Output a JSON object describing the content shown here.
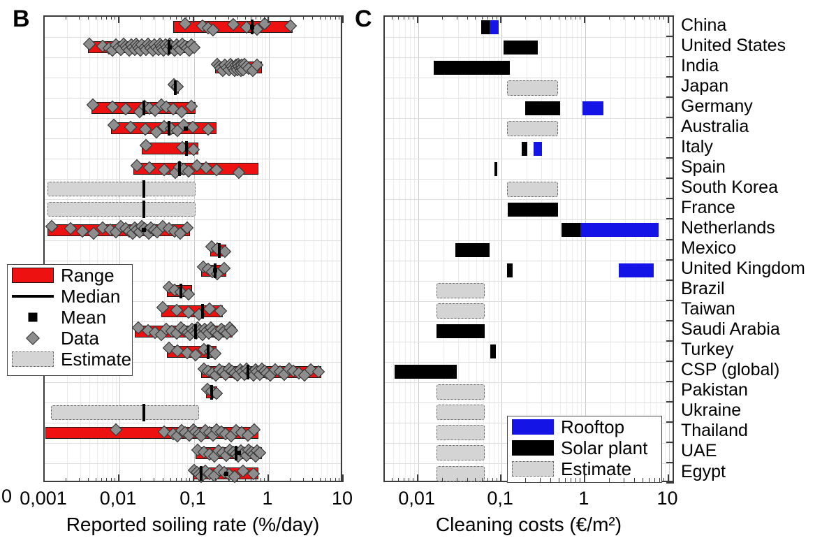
{
  "figure": {
    "panels": [
      {
        "letter": "B",
        "axis_title": "Reported soiling rate (%/day)"
      },
      {
        "letter": "C",
        "axis_title": "Cleaning costs (€/m²)"
      }
    ],
    "zero_label": "0"
  },
  "categories": [
    "China",
    "United States",
    "India",
    "Japan",
    "Germany",
    "Australia",
    "Italy",
    "Spain",
    "South Korea",
    "France",
    "Netherlands",
    "Mexico",
    "United Kingdom",
    "Brazil",
    "Taiwan",
    "Saudi Arabia",
    "Turkey",
    "CSP (global)",
    "Pakistan",
    "Ukraine",
    "Thailand",
    "UAE",
    "Egypt"
  ],
  "legend_b": {
    "items": [
      {
        "label": "Range",
        "kind": "red"
      },
      {
        "label": "Median",
        "kind": "line"
      },
      {
        "label": "Mean",
        "kind": "sq"
      },
      {
        "label": "Data",
        "kind": "dia"
      },
      {
        "label": "Estimate",
        "kind": "est"
      }
    ]
  },
  "legend_c": {
    "items": [
      {
        "label": "Rooftop",
        "kind": "blue"
      },
      {
        "label": "Solar plant",
        "kind": "black"
      },
      {
        "label": "Estimate",
        "kind": "est"
      }
    ]
  },
  "colors": {
    "range": "#ee1111",
    "rooftop": "#1414e6",
    "solar_plant": "#000000",
    "estimate": "#d4d4d4",
    "data_marker": "#8d8d8d"
  },
  "chart_data": [
    {
      "type": "bar",
      "id": "panel_b",
      "title": "B",
      "xlabel": "Reported soiling rate (%/day)",
      "ylabel": "",
      "xscale": "log",
      "xlim": [
        0.001,
        10
      ],
      "xticks": [
        0.001,
        0.01,
        0.1,
        1,
        10
      ],
      "xticklabels": [
        "0,001",
        "0,01",
        "0,1",
        "1",
        "10"
      ],
      "grid": true,
      "legend": [
        "Range",
        "Median",
        "Mean",
        "Data",
        "Estimate"
      ],
      "categories": [
        "China",
        "United States",
        "India",
        "Japan",
        "Germany",
        "Australia",
        "Italy",
        "Spain",
        "South Korea",
        "France",
        "Netherlands",
        "Mexico",
        "United Kingdom",
        "Brazil",
        "Taiwan",
        "Saudi Arabia",
        "Turkey",
        "CSP (global)",
        "Pakistan",
        "Ukraine",
        "Thailand",
        "UAE",
        "Egypt"
      ],
      "series": [
        {
          "category": "China",
          "kind": "range",
          "low": 0.052,
          "high": 2.1,
          "median": 0.6,
          "mean": 0.6,
          "n_data": 9
        },
        {
          "category": "United States",
          "kind": "range",
          "low": 0.0038,
          "high": 0.105,
          "median": 0.046,
          "mean": 0.047,
          "n_data": 48
        },
        {
          "category": "India",
          "kind": "range",
          "low": 0.19,
          "high": 0.8,
          "median": null,
          "mean": null,
          "n_data": 26
        },
        {
          "category": "Japan",
          "kind": "range",
          "low": 0.053,
          "high": 0.062,
          "median": 0.056,
          "mean": null,
          "n_data": 2
        },
        {
          "category": "Germany",
          "kind": "range",
          "low": 0.0042,
          "high": 0.105,
          "median": 0.021,
          "mean": null,
          "n_data": 12
        },
        {
          "category": "Australia",
          "kind": "range",
          "low": 0.0077,
          "high": 0.2,
          "median": 0.046,
          "mean": 0.077,
          "n_data": 10
        },
        {
          "category": "Italy",
          "kind": "range",
          "low": 0.02,
          "high": 0.115,
          "median": 0.078,
          "mean": null,
          "n_data": 3
        },
        {
          "category": "Spain",
          "kind": "range",
          "low": 0.0155,
          "high": 0.72,
          "median": 0.063,
          "mean": null,
          "n_data": 11
        },
        {
          "category": "South Korea",
          "kind": "estimate",
          "low": 0.0011,
          "high": 0.105,
          "median": 0.021,
          "mean": null,
          "n_data": 0
        },
        {
          "category": "France",
          "kind": "estimate",
          "low": 0.0011,
          "high": 0.105,
          "median": 0.021,
          "mean": null,
          "n_data": 0
        },
        {
          "category": "Netherlands",
          "kind": "range",
          "low": 0.0011,
          "high": 0.088,
          "median": null,
          "mean": 0.021,
          "n_data": 26
        },
        {
          "category": "Mexico",
          "kind": "range",
          "low": 0.165,
          "high": 0.27,
          "median": 0.215,
          "mean": null,
          "n_data": 3
        },
        {
          "category": "United Kingdom",
          "kind": "range",
          "low": 0.125,
          "high": 0.27,
          "median": 0.19,
          "mean": 0.19,
          "n_data": 5
        },
        {
          "category": "Brazil",
          "kind": "range",
          "low": 0.043,
          "high": 0.093,
          "median": 0.066,
          "mean": null,
          "n_data": 4
        },
        {
          "category": "Taiwan",
          "kind": "range",
          "low": 0.036,
          "high": 0.24,
          "median": 0.13,
          "mean": null,
          "n_data": 6
        },
        {
          "category": "Saudi Arabia",
          "kind": "range",
          "low": 0.016,
          "high": 0.33,
          "median": 0.105,
          "mean": null,
          "n_data": 30
        },
        {
          "category": "Turkey",
          "kind": "range",
          "low": 0.043,
          "high": 0.2,
          "median": 0.155,
          "mean": null,
          "n_data": 7
        },
        {
          "category": "CSP (global)",
          "kind": "range",
          "low": 0.125,
          "high": 5.0,
          "median": 0.52,
          "mean": null,
          "n_data": 34
        },
        {
          "category": "Pakistan",
          "kind": "range",
          "low": 0.145,
          "high": 0.205,
          "median": 0.17,
          "mean": null,
          "n_data": 3
        },
        {
          "category": "Ukraine",
          "kind": "estimate",
          "low": 0.0012,
          "high": 0.115,
          "median": 0.021,
          "mean": null,
          "n_data": 0
        },
        {
          "category": "Thailand",
          "kind": "range",
          "low": 0.00102,
          "high": 0.72,
          "median": null,
          "mean": null,
          "n_data": 22
        },
        {
          "category": "UAE",
          "kind": "range",
          "low": 0.105,
          "high": 0.8,
          "median": 0.36,
          "mean": 0.4,
          "n_data": 20
        },
        {
          "category": "Egypt",
          "kind": "range",
          "low": 0.095,
          "high": 0.72,
          "median": 0.125,
          "mean": 0.27,
          "n_data": 13
        }
      ]
    },
    {
      "type": "bar",
      "id": "panel_c",
      "title": "C",
      "xlabel": "Cleaning costs (€/m²)",
      "ylabel": "",
      "xscale": "log",
      "xlim": [
        0.004,
        12
      ],
      "xticks": [
        0.01,
        0.1,
        1,
        10
      ],
      "xticklabels": [
        "0,01",
        "0,1",
        "1",
        "10"
      ],
      "grid": true,
      "legend": [
        "Rooftop",
        "Solar plant",
        "Estimate"
      ],
      "categories": [
        "China",
        "United States",
        "India",
        "Japan",
        "Germany",
        "Australia",
        "Italy",
        "Spain",
        "South Korea",
        "France",
        "Netherlands",
        "Mexico",
        "United Kingdom",
        "Brazil",
        "Taiwan",
        "Saudi Arabia",
        "Turkey",
        "CSP (global)",
        "Pakistan",
        "Ukraine",
        "Thailand",
        "UAE",
        "Egypt"
      ],
      "bars": [
        {
          "category": "China",
          "segments": [
            {
              "kind": "solar_plant",
              "low": 0.057,
              "high": 0.072
            },
            {
              "kind": "rooftop",
              "low": 0.072,
              "high": 0.093
            }
          ]
        },
        {
          "category": "United States",
          "segments": [
            {
              "kind": "solar_plant",
              "low": 0.105,
              "high": 0.27
            }
          ]
        },
        {
          "category": "India",
          "segments": [
            {
              "kind": "solar_plant",
              "low": 0.0155,
              "high": 0.125
            }
          ]
        },
        {
          "category": "Japan",
          "segments": [
            {
              "kind": "estimate",
              "low": 0.115,
              "high": 0.47
            }
          ]
        },
        {
          "category": "Germany",
          "segments": [
            {
              "kind": "solar_plant",
              "low": 0.19,
              "high": 0.5
            },
            {
              "kind": "rooftop",
              "low": 0.93,
              "high": 1.65
            }
          ]
        },
        {
          "category": "Australia",
          "segments": [
            {
              "kind": "estimate",
              "low": 0.115,
              "high": 0.47
            }
          ]
        },
        {
          "category": "Italy",
          "segments": [
            {
              "kind": "solar_plant",
              "low": 0.175,
              "high": 0.205
            },
            {
              "kind": "rooftop",
              "low": 0.24,
              "high": 0.305
            }
          ]
        },
        {
          "category": "Spain",
          "segments": [
            {
              "kind": "solar_plant",
              "low": 0.082,
              "high": 0.089
            }
          ]
        },
        {
          "category": "South Korea",
          "segments": [
            {
              "kind": "estimate",
              "low": 0.115,
              "high": 0.47
            }
          ]
        },
        {
          "category": "France",
          "segments": [
            {
              "kind": "solar_plant",
              "low": 0.118,
              "high": 0.47
            }
          ]
        },
        {
          "category": "Netherlands",
          "segments": [
            {
              "kind": "solar_plant",
              "low": 0.52,
              "high": 0.88
            },
            {
              "kind": "rooftop",
              "low": 0.88,
              "high": 7.6
            }
          ]
        },
        {
          "category": "Mexico",
          "segments": [
            {
              "kind": "solar_plant",
              "low": 0.028,
              "high": 0.072
            }
          ]
        },
        {
          "category": "United Kingdom",
          "segments": [
            {
              "kind": "solar_plant",
              "low": 0.115,
              "high": 0.135
            },
            {
              "kind": "rooftop",
              "low": 2.5,
              "high": 6.6
            }
          ]
        },
        {
          "category": "Brazil",
          "segments": [
            {
              "kind": "estimate",
              "low": 0.0165,
              "high": 0.063
            }
          ]
        },
        {
          "category": "Taiwan",
          "segments": [
            {
              "kind": "estimate",
              "low": 0.0165,
              "high": 0.063
            }
          ]
        },
        {
          "category": "Saudi Arabia",
          "segments": [
            {
              "kind": "solar_plant",
              "low": 0.0165,
              "high": 0.063
            }
          ]
        },
        {
          "category": "Turkey",
          "segments": [
            {
              "kind": "solar_plant",
              "low": 0.073,
              "high": 0.086
            }
          ]
        },
        {
          "category": "CSP (global)",
          "segments": [
            {
              "kind": "solar_plant",
              "low": 0.0052,
              "high": 0.029
            }
          ]
        },
        {
          "category": "Pakistan",
          "segments": [
            {
              "kind": "estimate",
              "low": 0.0165,
              "high": 0.063
            }
          ]
        },
        {
          "category": "Ukraine",
          "segments": [
            {
              "kind": "estimate",
              "low": 0.0165,
              "high": 0.063
            }
          ]
        },
        {
          "category": "Thailand",
          "segments": [
            {
              "kind": "estimate",
              "low": 0.0165,
              "high": 0.063
            }
          ]
        },
        {
          "category": "UAE",
          "segments": [
            {
              "kind": "estimate",
              "low": 0.0165,
              "high": 0.063
            }
          ]
        },
        {
          "category": "Egypt",
          "segments": [
            {
              "kind": "estimate",
              "low": 0.0165,
              "high": 0.063
            }
          ]
        }
      ]
    }
  ],
  "panel_b_points": {
    "China": [
      0.075,
      0.13,
      0.155,
      0.18,
      0.33,
      0.5,
      0.7,
      0.88,
      1.95
    ],
    "United States": [
      0.004,
      0.006,
      0.0072,
      0.008,
      0.009,
      0.0097,
      0.0105,
      0.0113,
      0.012,
      0.0126,
      0.0135,
      0.0143,
      0.015,
      0.016,
      0.0168,
      0.0175,
      0.0182,
      0.019,
      0.02,
      0.0215,
      0.0228,
      0.024,
      0.0255,
      0.0265,
      0.028,
      0.0295,
      0.031,
      0.033,
      0.0345,
      0.036,
      0.0375,
      0.039,
      0.041,
      0.043,
      0.045,
      0.047,
      0.049,
      0.052,
      0.055,
      0.058,
      0.061,
      0.065,
      0.07,
      0.075,
      0.08,
      0.086,
      0.092,
      0.099
    ],
    "India": [
      0.205,
      0.215,
      0.225,
      0.24,
      0.26,
      0.275,
      0.29,
      0.305,
      0.32,
      0.335,
      0.35,
      0.36,
      0.37,
      0.38,
      0.39,
      0.4,
      0.41,
      0.42,
      0.43,
      0.44,
      0.45,
      0.47,
      0.5,
      0.54,
      0.61,
      0.7
    ],
    "Japan": [
      0.054,
      0.06
    ],
    "Germany": [
      0.0044,
      0.008,
      0.012,
      0.0185,
      0.0215,
      0.025,
      0.03,
      0.036,
      0.042,
      0.052,
      0.068,
      0.092
    ],
    "Australia": [
      0.0085,
      0.014,
      0.022,
      0.031,
      0.04,
      0.049,
      0.06,
      0.072,
      0.095,
      0.155
    ],
    "Italy": [
      0.0225,
      0.07,
      0.098
    ],
    "Spain": [
      0.017,
      0.025,
      0.04,
      0.056,
      0.064,
      0.072,
      0.084,
      0.11,
      0.145,
      0.2,
      0.4
    ],
    "Netherlands": [
      0.00125,
      0.0022,
      0.0032,
      0.0045,
      0.006,
      0.0075,
      0.009,
      0.0105,
      0.012,
      0.0135,
      0.015,
      0.016,
      0.0172,
      0.0185,
      0.02,
      0.0215,
      0.023,
      0.0245,
      0.0265,
      0.029,
      0.032,
      0.038,
      0.046,
      0.055,
      0.065,
      0.08
    ],
    "Mexico": [
      0.172,
      0.205,
      0.255
    ],
    "United Kingdom": [
      0.132,
      0.155,
      0.175,
      0.205,
      0.25
    ],
    "Brazil": [
      0.046,
      0.055,
      0.066,
      0.085
    ],
    "Taiwan": [
      0.038,
      0.058,
      0.085,
      0.115,
      0.16,
      0.225
    ],
    "Saudi Arabia": [
      0.018,
      0.024,
      0.03,
      0.036,
      0.042,
      0.05,
      0.058,
      0.066,
      0.074,
      0.082,
      0.088,
      0.094,
      0.1,
      0.106,
      0.112,
      0.118,
      0.124,
      0.13,
      0.138,
      0.148,
      0.158,
      0.168,
      0.18,
      0.195,
      0.21,
      0.23,
      0.25,
      0.275,
      0.3,
      0.32
    ],
    "Turkey": [
      0.046,
      0.06,
      0.08,
      0.105,
      0.135,
      0.165,
      0.19
    ],
    "CSP (global)": [
      0.135,
      0.155,
      0.175,
      0.195,
      0.215,
      0.24,
      0.265,
      0.29,
      0.32,
      0.35,
      0.38,
      0.41,
      0.44,
      0.47,
      0.5,
      0.54,
      0.58,
      0.62,
      0.66,
      0.7,
      0.75,
      0.8,
      0.87,
      0.94,
      1.05,
      1.2,
      1.4,
      1.6,
      1.85,
      2.1,
      2.5,
      3.0,
      3.6,
      4.6
    ],
    "Pakistan": [
      0.15,
      0.172,
      0.198
    ],
    "Thailand": [
      0.009,
      0.04,
      0.052,
      0.06,
      0.068,
      0.076,
      0.086,
      0.098,
      0.105,
      0.115,
      0.125,
      0.14,
      0.16,
      0.18,
      0.2,
      0.23,
      0.265,
      0.31,
      0.36,
      0.43,
      0.52,
      0.64
    ],
    "UAE": [
      0.112,
      0.135,
      0.16,
      0.185,
      0.21,
      0.24,
      0.27,
      0.3,
      0.33,
      0.36,
      0.39,
      0.42,
      0.46,
      0.5,
      0.54,
      0.58,
      0.62,
      0.66,
      0.7,
      0.75
    ],
    "Egypt": [
      0.1,
      0.108,
      0.115,
      0.125,
      0.14,
      0.16,
      0.185,
      0.215,
      0.25,
      0.29,
      0.35,
      0.45,
      0.62
    ]
  }
}
